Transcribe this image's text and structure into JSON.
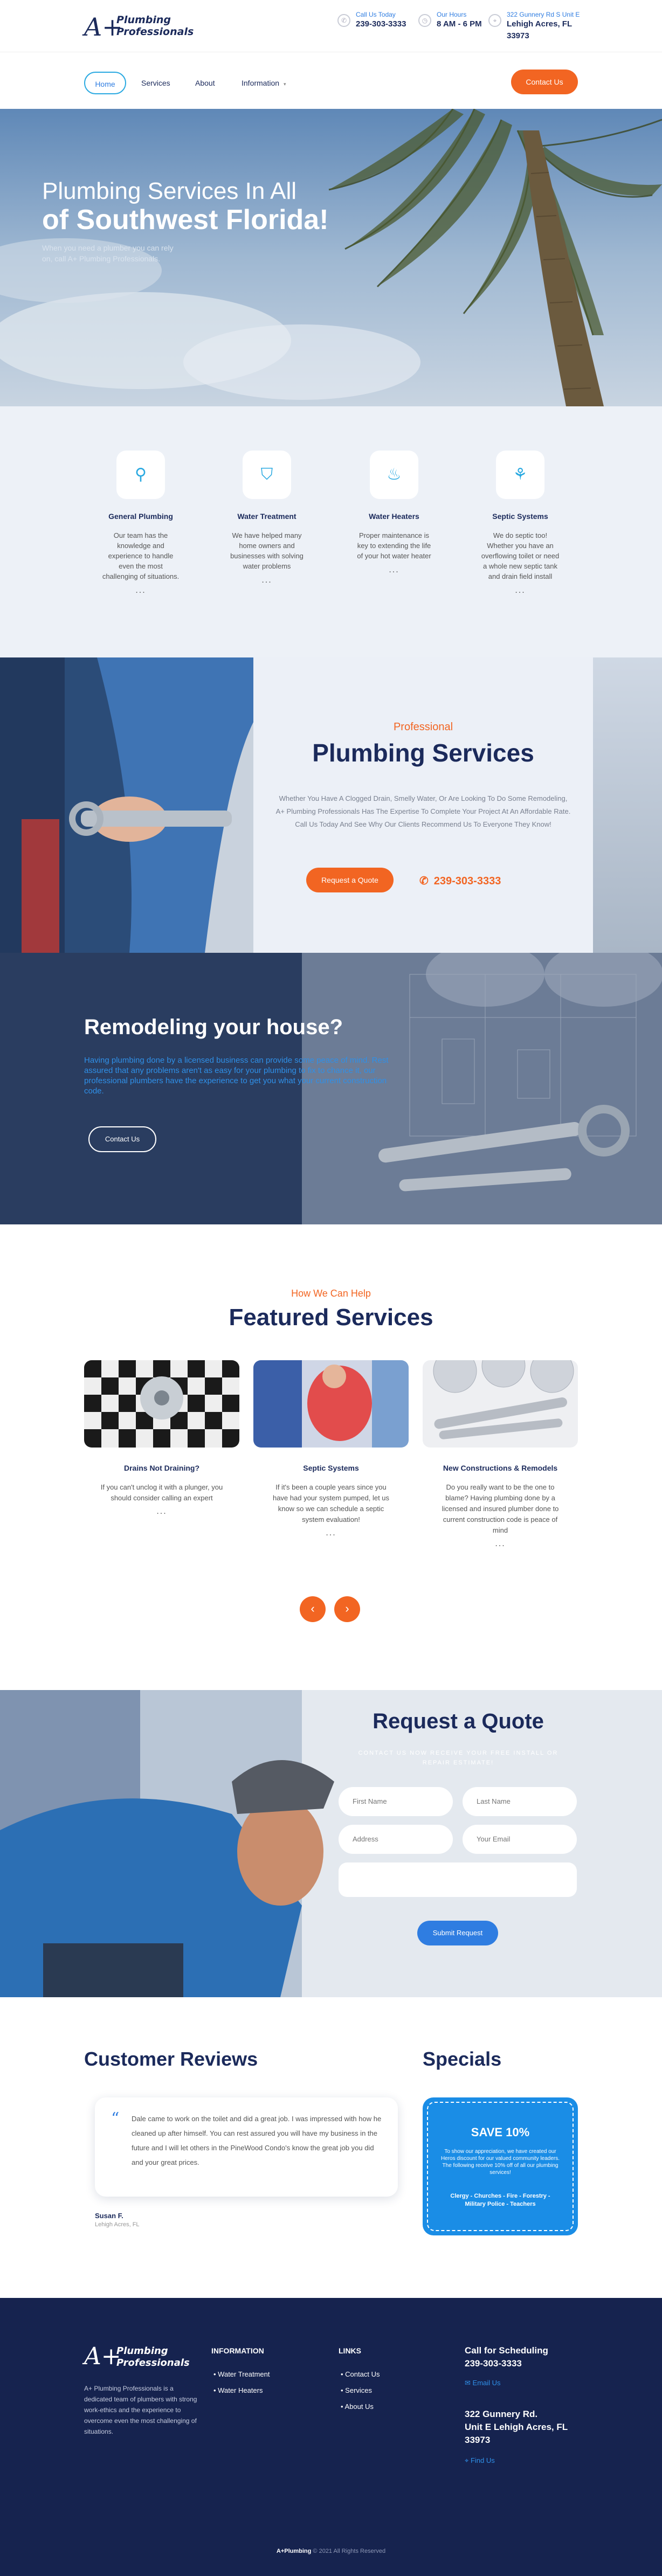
{
  "header": {
    "logo": {
      "mark": "A+",
      "line1": "Plumbing",
      "line2": "Professionals"
    },
    "call": {
      "label": "Call Us Today",
      "value": "239-303-3333"
    },
    "hours": {
      "label": "Our Hours",
      "value": "8 AM - 6 PM"
    },
    "address": {
      "label": "322 Gunnery Rd S Unit E",
      "line1": "Lehigh Acres, FL",
      "line2": "33973"
    },
    "colors": {
      "accent": "#f26522",
      "brand": "#1b2a5b",
      "blue": "#2f7de1"
    }
  },
  "nav": {
    "items": [
      "Home",
      "Services",
      "About",
      "Information"
    ],
    "cta": "Contact Us"
  },
  "hero": {
    "line1": "Plumbing Services In All",
    "line2": "of Southwest Florida!",
    "sub": "When you need a plumber you can rely on, call A+ Plumbing Professionals."
  },
  "services": [
    {
      "icon": "faucet-icon",
      "title": "General Plumbing",
      "text": "Our team has the knowledge and experience to handle even the most challenging of situations.",
      "more": "..."
    },
    {
      "icon": "water-treatment-icon",
      "title": "Water Treatment",
      "text": "We have helped many home owners and businesses with solving water problems",
      "more": "..."
    },
    {
      "icon": "water-heater-icon",
      "title": "Water Heaters",
      "text": "Proper maintenance is key to extending the life of your hot water heater",
      "more": "..."
    },
    {
      "icon": "septic-icon",
      "title": "Septic Systems",
      "text": "We do septic too! Whether you have an overflowing toilet or need a whole new septic tank and drain field install",
      "more": "..."
    }
  ],
  "professional": {
    "kicker": "Professional",
    "title": "Plumbing Services",
    "text": "Whether You Have A Clogged Drain, Smelly Water, Or Are Looking To Do Some Remodeling, A+ Plumbing Professionals Has The Expertise To Complete Your Project At An Affordable Rate. Call Us Today And See Why Our Clients Recommend Us To Everyone They Know!",
    "cta": "Request a Quote",
    "phone": "239-303-3333"
  },
  "remodel": {
    "title": "Remodeling your house?",
    "text": "Having plumbing done by a licensed business can provide some peace of mind. Rest assured that any problems aren't as easy for your plumbing to fix to chance it, our professional plumbers have the experience to get you what your current construction code.",
    "cta": "Contact Us"
  },
  "featured": {
    "kicker": "How We Can Help",
    "title": "Featured Services",
    "cards": [
      {
        "title": "Drains Not Draining?",
        "text": "If you can't unclog it with a plunger, you should consider calling an expert",
        "more": "..."
      },
      {
        "title": "Septic Systems",
        "text": "If it's been a couple years since you have had your system pumped, let us know so we can schedule a septic system evaluation!",
        "more": "..."
      },
      {
        "title": "New Constructions & Remodels",
        "text": "Do you really want to be the one to blame? Having plumbing done by a licensed and insured plumber done to current construction code is peace of mind",
        "more": "..."
      }
    ],
    "prev": "‹",
    "next": "›"
  },
  "quote": {
    "title": "Request a Quote",
    "sub": "CONTACT US NOW RECEIVE YOUR FREE INSTALL OR REPAIR ESTIMATE!",
    "fields": {
      "first": "First Name",
      "last": "Last Name",
      "address": "Address",
      "email": "Your Email",
      "message": ""
    },
    "submit": "Submit Request"
  },
  "reviews": {
    "title": "Customer Reviews",
    "quote": "Dale came to work on the toilet and did a great job. I was impressed with how he cleaned up after himself. You can rest assured you will have my business in the future and I will let others in the PineWood Condo's know the great job you did and your great prices.",
    "name": "Susan F.",
    "location": "Lehigh Acres, FL"
  },
  "specials": {
    "title": "Specials",
    "offer": "SAVE 10%",
    "text": "To show our appreciation, we have created our Heros discount for our valued community leaders. The following receive 10% off of all our plumbing services!",
    "groups": "Clergy - Churches - Fire - Forestry - Military Police - Teachers"
  },
  "footer": {
    "about": "A+ Plumbing Professionals is a dedicated team of plumbers with strong work-ethics and the experience to overcome even the most challenging of situations.",
    "info_title": "INFORMATION",
    "info_items": [
      "Water Treatment",
      "Water Heaters"
    ],
    "links_title": "LINKS",
    "links_items": [
      "Contact Us",
      "Services",
      "About Us"
    ],
    "call_title": "Call for Scheduling",
    "call_phone": "239-303-3333",
    "email_label": "Email Us",
    "address1": "322 Gunnery Rd.",
    "address2": "Unit E Lehigh Acres, FL",
    "address3": "33973",
    "find_label": "Find Us",
    "copyright_brand": "A+Plumbing",
    "copyright": "© 2021 All Rights Reserved"
  }
}
